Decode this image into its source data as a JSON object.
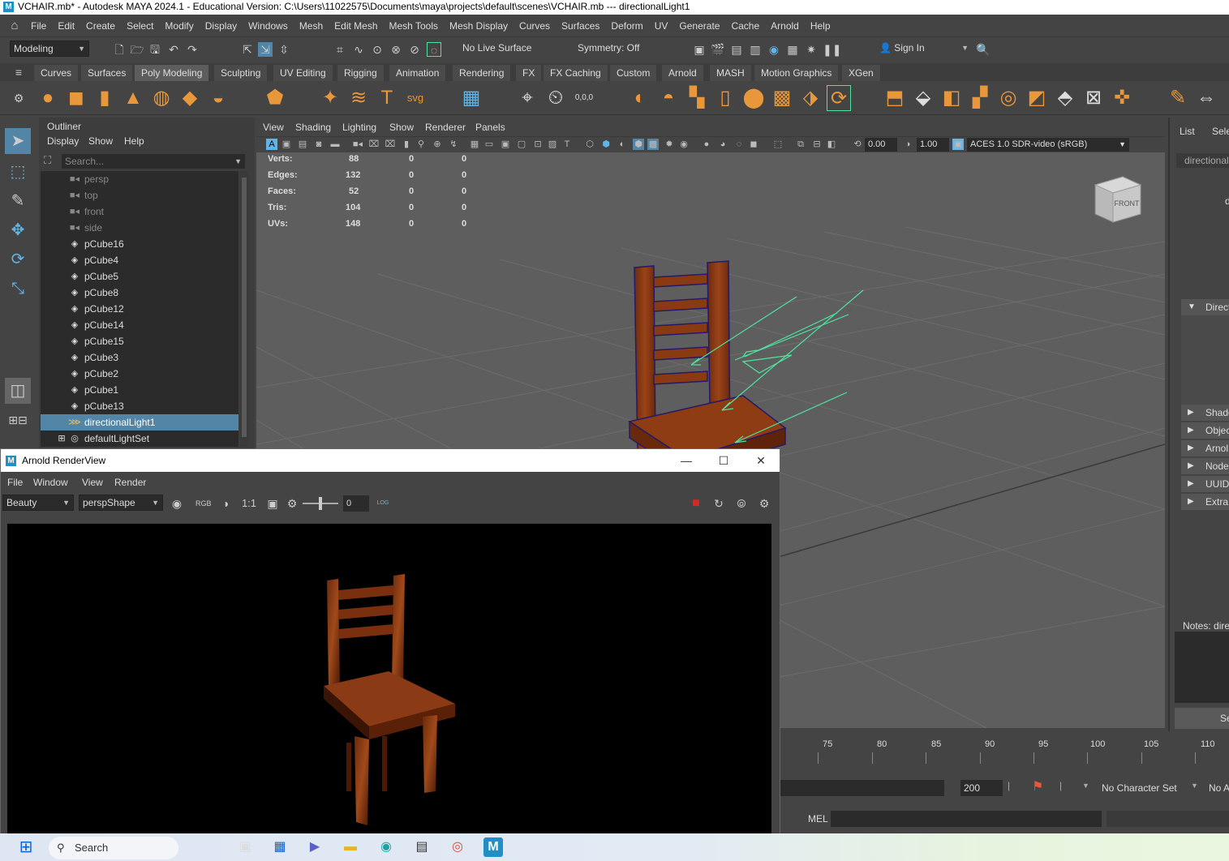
{
  "window": {
    "title": "VCHAIR.mb* - Autodesk MAYA 2024.1 - Educational Version: C:\\Users\\11022575\\Documents\\maya\\projects\\default\\scenes\\VCHAIR.mb   ---   directionalLight1",
    "logo_letter": "M"
  },
  "menubar": {
    "items": [
      "File",
      "Edit",
      "Create",
      "Select",
      "Modify",
      "Display",
      "Windows",
      "Mesh",
      "Edit Mesh",
      "Mesh Tools",
      "Mesh Display",
      "Curves",
      "Surfaces",
      "Deform",
      "UV",
      "Generate",
      "Cache",
      "Arnold",
      "Help"
    ]
  },
  "statusline": {
    "mode": "Modeling",
    "live_surface": "No Live Surface",
    "symmetry": "Symmetry: Off",
    "sign_in": "Sign In"
  },
  "shelf": {
    "tabs": [
      "Curves",
      "Surfaces",
      "Poly Modeling",
      "Sculpting",
      "UV Editing",
      "Rigging",
      "Animation",
      "Rendering",
      "FX",
      "FX Caching",
      "Custom",
      "Arnold",
      "MASH",
      "Motion Graphics",
      "XGen"
    ],
    "active_tab": "Poly Modeling",
    "svg_label": "svg",
    "zero_label": "0,0,0"
  },
  "outliner": {
    "title": "Outliner",
    "menu": [
      "Display",
      "Show",
      "Help"
    ],
    "search_placeholder": "Search...",
    "items": [
      {
        "label": "persp",
        "icon": "camera-icon",
        "dim": true
      },
      {
        "label": "top",
        "icon": "camera-icon",
        "dim": true
      },
      {
        "label": "front",
        "icon": "camera-icon",
        "dim": true
      },
      {
        "label": "side",
        "icon": "camera-icon",
        "dim": true
      },
      {
        "label": "pCube16",
        "icon": "mesh-icon"
      },
      {
        "label": "pCube4",
        "icon": "mesh-icon"
      },
      {
        "label": "pCube5",
        "icon": "mesh-icon"
      },
      {
        "label": "pCube8",
        "icon": "mesh-icon"
      },
      {
        "label": "pCube12",
        "icon": "mesh-icon"
      },
      {
        "label": "pCube14",
        "icon": "mesh-icon"
      },
      {
        "label": "pCube15",
        "icon": "mesh-icon"
      },
      {
        "label": "pCube3",
        "icon": "mesh-icon"
      },
      {
        "label": "pCube2",
        "icon": "mesh-icon"
      },
      {
        "label": "pCube1",
        "icon": "mesh-icon"
      },
      {
        "label": "pCube13",
        "icon": "mesh-icon"
      },
      {
        "label": "directionalLight1",
        "icon": "light-icon",
        "selected": true
      },
      {
        "label": "defaultLightSet",
        "icon": "set-icon",
        "expandable": true
      }
    ]
  },
  "viewport": {
    "menu": [
      "View",
      "Shading",
      "Lighting",
      "Show",
      "Renderer",
      "Panels"
    ],
    "exposure": "0.00",
    "gamma": "1.00",
    "color_space": "ACES 1.0 SDR-video (sRGB)",
    "hud": [
      {
        "label": "Verts:",
        "v1": "88",
        "v2": "0",
        "v3": "0"
      },
      {
        "label": "Edges:",
        "v1": "132",
        "v2": "0",
        "v3": "0"
      },
      {
        "label": "Faces:",
        "v1": "52",
        "v2": "0",
        "v3": "0"
      },
      {
        "label": "Tris:",
        "v1": "104",
        "v2": "0",
        "v3": "0"
      },
      {
        "label": "UVs:",
        "v1": "148",
        "v2": "0",
        "v3": "0"
      }
    ],
    "viewcube_label": "FRONT"
  },
  "attribute_editor": {
    "tabs": [
      "List",
      "Select"
    ],
    "node_field": "directional",
    "side_letter": "d",
    "sections": [
      "Direct",
      "Shado",
      "Objec",
      "Arnol",
      "Node",
      "UUID",
      "Extra"
    ],
    "notes_label": "Notes:  dire",
    "bottom_button": "Se"
  },
  "timeslider": {
    "ticks": [
      "75",
      "80",
      "85",
      "90",
      "95",
      "100",
      "105",
      "110"
    ],
    "end_frame": "200",
    "character_set": "No Character Set",
    "anim_layer": "No A",
    "command_label": "MEL"
  },
  "renderview": {
    "title": "Arnold RenderView",
    "menu": [
      "File",
      "Window",
      "View",
      "Render"
    ],
    "aov": "Beauty",
    "camera": "perspShape",
    "ratio": "1:1",
    "exposure_value": "0",
    "log_label": "LOG"
  },
  "taskbar": {
    "search_placeholder": "Search"
  },
  "colors": {
    "maya_bg": "#444444",
    "viewport_bg": "#5e5e5e",
    "selection": "#5285a6",
    "shelf_icon": "#e8973a",
    "light_arrows": "#4fe3a0",
    "chair_wood": "#8a3a12"
  }
}
